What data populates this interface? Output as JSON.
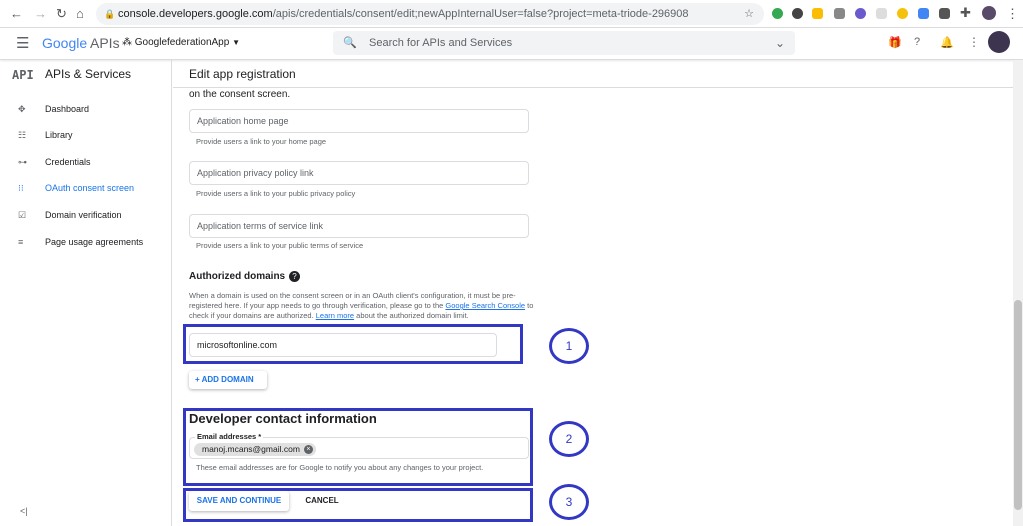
{
  "browser": {
    "url_host": "console.developers.google.com",
    "url_path": "/apis/credentials/consent/edit;newAppInternalUser=false?project=meta-triode-296908"
  },
  "header": {
    "logo_google": "Google",
    "logo_apis": "APIs",
    "project": "GooglefederationApp",
    "search_placeholder": "Search for APIs and Services"
  },
  "sidebar": {
    "api_badge": "API",
    "title": "APIs & Services",
    "items": [
      {
        "label": "Dashboard",
        "icon": "✥"
      },
      {
        "label": "Library",
        "icon": "☷"
      },
      {
        "label": "Credentials",
        "icon": "⊶"
      },
      {
        "label": "OAuth consent screen",
        "icon": "⁝⁝"
      },
      {
        "label": "Domain verification",
        "icon": "☑"
      },
      {
        "label": "Page usage agreements",
        "icon": "≡"
      }
    ],
    "collapse": "<|"
  },
  "main": {
    "title": "Edit app registration",
    "consent_tail": "on the consent screen.",
    "home_placeholder": "Application home page",
    "home_hint": "Provide users a link to your home page",
    "privacy_placeholder": "Application privacy policy link",
    "privacy_hint": "Provide users a link to your public privacy policy",
    "tos_placeholder": "Application terms of service link",
    "tos_hint": "Provide users a link to your public terms of service",
    "domains_title": "Authorized domains",
    "domains_desc_1": "When a domain is used on the consent screen or in an OAuth client's configuration, it must be pre-registered here. If your app needs to go through verification, please go to the ",
    "domains_link_1": "Google Search Console",
    "domains_desc_2": " to check if your domains are authorized. ",
    "domains_link_2": "Learn more",
    "domains_desc_3": " about the authorized domain limit.",
    "domain_value": "microsoftonline.com",
    "add_domain": "ADD DOMAIN",
    "dev_title": "Developer contact information",
    "email_label": "Email addresses *",
    "email_chip": "manoj.mcans@gmail.com",
    "email_hint": "These email addresses are for Google to notify you about any changes to your project.",
    "save": "SAVE AND CONTINUE",
    "cancel": "CANCEL"
  },
  "annotations": [
    "1",
    "2",
    "3"
  ]
}
